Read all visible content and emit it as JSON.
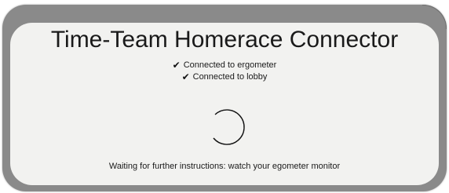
{
  "app": {
    "title": "Time-Team Homerace Connector"
  },
  "status": {
    "items": [
      {
        "icon": "check-icon",
        "label": "Connected to ergometer"
      },
      {
        "icon": "check-icon",
        "label": "Connected to lobby"
      }
    ]
  },
  "spinner": {
    "icon": "loading-spinner-icon"
  },
  "footer": {
    "message": "Waiting for further instructions: watch your egometer monitor"
  },
  "colors": {
    "frame": "#8a8a8a",
    "card": "#f2f2f0",
    "text": "#1a1a1a"
  }
}
